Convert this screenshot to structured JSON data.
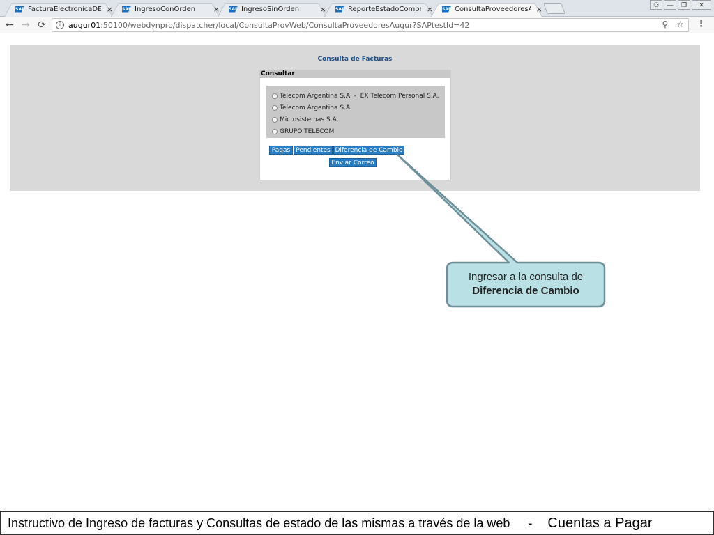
{
  "browser": {
    "tabs": [
      {
        "label": "FacturaElectronicaDES_Q",
        "active": false
      },
      {
        "label": "IngresoConOrden",
        "active": false
      },
      {
        "label": "IngresoSinOrden",
        "active": false
      },
      {
        "label": "ReporteEstadoComproba",
        "active": false
      },
      {
        "label": "ConsultaProveedoresAug",
        "active": true
      }
    ],
    "tab_icon_text": "SAP",
    "close_glyph": "×",
    "url_host": "augur01",
    "url_rest": ":50100/webdynpro/dispatcher/local/ConsultaProvWeb/ConsultaProveedoresAugur?SAPtestId=42",
    "back_glyph": "←",
    "forward_glyph": "→",
    "reload_glyph": "⟳",
    "menu_glyph": "⋮",
    "star_glyph": "☆",
    "key_glyph": "⚲",
    "info_glyph": "i",
    "win_user": "⚇",
    "win_min": "—",
    "win_max": "❐",
    "win_close": "✕"
  },
  "page": {
    "title": "Consulta de Facturas",
    "section_label": "Consultar",
    "options": [
      "Telecom Argentina S.A. -  EX Telecom Personal S.A.",
      "Telecom Argentina S.A.",
      "Microsistemas S.A.",
      "GRUPO TELECOM"
    ],
    "buttons": {
      "pagas": "Pagas",
      "pendientes": "Pendientes",
      "diferencia": "Diferencia de Cambio",
      "correo": "Enviar Correo"
    }
  },
  "callout": {
    "line1": "Ingresar a la consulta de",
    "line2": "Diferencia de Cambio",
    "fill": "#b9e0e4",
    "stroke": "#6f8f99"
  },
  "footer": {
    "left": "Instructivo de Ingreso de facturas y Consultas de estado de las mismas a través de la web",
    "separator": "-",
    "right": "Cuentas a Pagar"
  }
}
